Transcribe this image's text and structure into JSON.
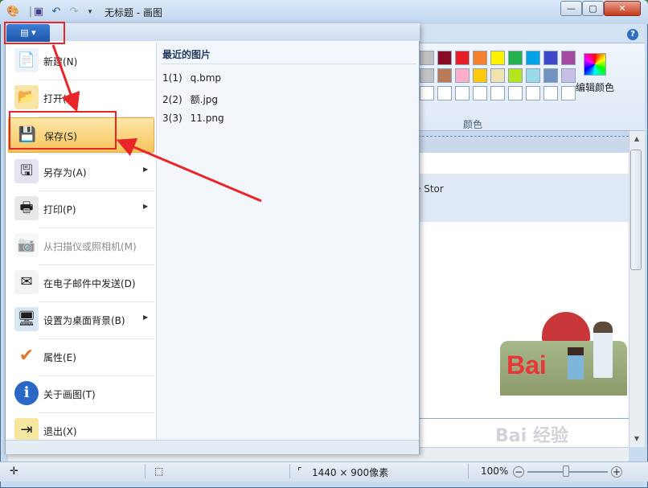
{
  "window": {
    "title": "无标题 - 画图",
    "min_label": "—",
    "max_label": "▢",
    "close_label": "✕"
  },
  "ribbon": {
    "help_label": "?",
    "colors_group_label": "颜色",
    "edit_colors_label": "编辑颜色",
    "palette_row1": [
      "#c0c0c0",
      "#8a0c24",
      "#e81c24",
      "#f57f2a",
      "#fff200",
      "#22b14c",
      "#00a2e8",
      "#3f48cc",
      "#a349a4"
    ],
    "palette_row2": [
      "#c3c3c3",
      "#b97a57",
      "#ffaec9",
      "#ffc90e",
      "#efe4b0",
      "#b5e61d",
      "#99d9ea",
      "#7092be",
      "#c8bfe7"
    ],
    "palette_row3": [
      "#ffffff",
      "#ffffff",
      "#ffffff",
      "#ffffff",
      "#ffffff",
      "#ffffff",
      "#ffffff",
      "#ffffff",
      "#ffffff"
    ]
  },
  "canvas": {
    "partial_text": "e Stor",
    "logo_text": "Bai"
  },
  "app_menu": {
    "button_label": "▤ ▾",
    "items": [
      {
        "label": "新建(N)",
        "icon": "new-document-icon",
        "submenu": false,
        "disabled": false
      },
      {
        "label": "打开(O)",
        "icon": "open-folder-icon",
        "submenu": false,
        "disabled": false
      },
      {
        "label": "保存(S)",
        "icon": "save-disk-icon",
        "submenu": false,
        "disabled": false,
        "highlighted": true
      },
      {
        "label": "另存为(A)",
        "icon": "save-as-icon",
        "submenu": true,
        "disabled": false
      },
      {
        "label": "打印(P)",
        "icon": "printer-icon",
        "submenu": true,
        "disabled": false
      },
      {
        "label": "从扫描仪或照相机(M)",
        "icon": "scanner-icon",
        "submenu": false,
        "disabled": true
      },
      {
        "label": "在电子邮件中发送(D)",
        "icon": "email-icon",
        "submenu": false,
        "disabled": false
      },
      {
        "label": "设置为桌面背景(B)",
        "icon": "desktop-background-icon",
        "submenu": true,
        "disabled": false
      },
      {
        "label": "属性(E)",
        "icon": "checkmark-icon",
        "submenu": false,
        "disabled": false
      },
      {
        "label": "关于画图(T)",
        "icon": "info-icon",
        "submenu": false,
        "disabled": false
      },
      {
        "label": "退出(X)",
        "icon": "exit-icon",
        "submenu": false,
        "disabled": false
      }
    ],
    "recent_title": "最近的图片",
    "recent_files": [
      {
        "index": "1(1)",
        "name": "q.bmp"
      },
      {
        "index": "2(2)",
        "name": "额.jpg"
      },
      {
        "index": "3(3)",
        "name": "11.png"
      }
    ]
  },
  "statusbar": {
    "dimensions": "1440 × 900像素",
    "zoom": "100%",
    "zoom_minus": "−",
    "zoom_plus": "+"
  },
  "watermark": "Bai 经验"
}
